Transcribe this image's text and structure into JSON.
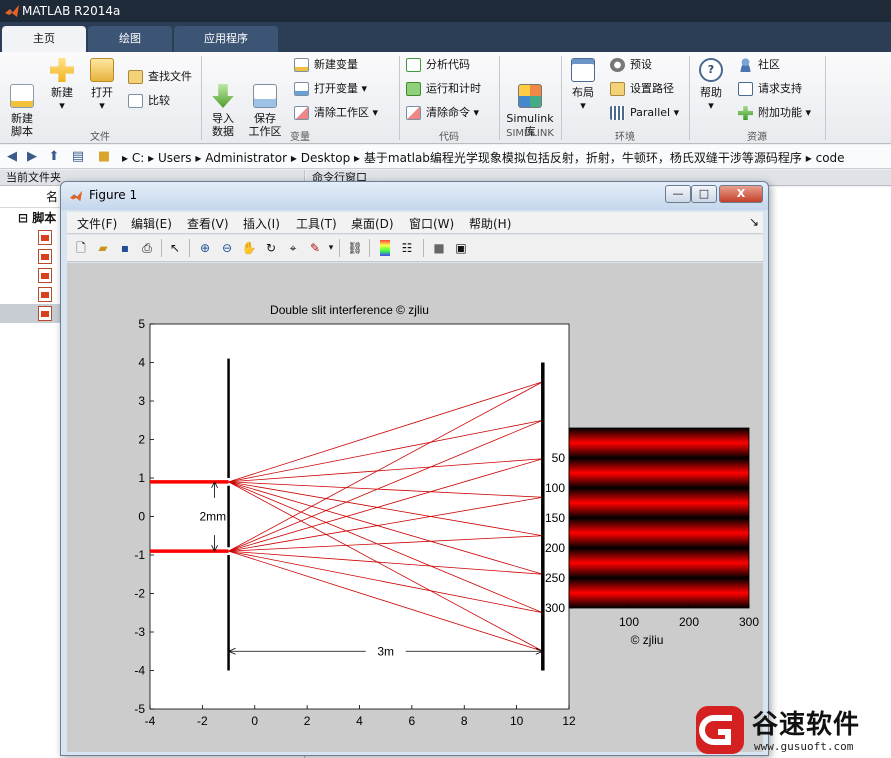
{
  "app": {
    "title": "MATLAB R2014a",
    "tabs": [
      "主页",
      "绘图",
      "应用程序"
    ]
  },
  "ribbon": {
    "new_script": "新建\n脚本",
    "new": "新建",
    "open": "打开",
    "find_files": "查找文件",
    "compare": "比较",
    "import_data": "导入\n数据",
    "save_workspace": "保存\n工作区",
    "new_variable": "新建变量",
    "open_variable": "打开变量",
    "clear_workspace": "清除工作区",
    "analyze_code": "分析代码",
    "run_and_time": "运行和计时",
    "clear_commands": "清除命令",
    "simulink": "Simulink\n库",
    "layout": "布局",
    "preferences": "预设",
    "set_path": "设置路径",
    "parallel": "Parallel",
    "help": "帮助",
    "community": "社区",
    "request_support": "请求支持",
    "add_ons": "附加功能",
    "sections": [
      "文件",
      "变量",
      "代码",
      "SIMULINK",
      "环境",
      "资源"
    ]
  },
  "address": {
    "path": [
      "C:",
      "Users",
      "Administrator",
      "Desktop",
      "基于matlab编程光学现象模拟包括反射，折射，牛顿环，杨氏双缝干涉等源码程序",
      "code"
    ]
  },
  "left_panel": {
    "title": "当前文件夹",
    "column": "名",
    "group": "脚本"
  },
  "command_window": {
    "title": "命令行窗口"
  },
  "figure": {
    "title": "Figure 1",
    "menu": [
      "文件(F)",
      "编辑(E)",
      "查看(V)",
      "插入(I)",
      "工具(T)",
      "桌面(D)",
      "窗口(W)",
      "帮助(H)"
    ],
    "menu_arrow": "↘",
    "window_buttons": {
      "minimize": "—",
      "maximize": "□",
      "close": "X"
    }
  },
  "chart_data": [
    {
      "type": "line",
      "title": "Double slit interference  © zjliu",
      "xlim": [
        -4,
        12
      ],
      "ylim": [
        -5,
        5
      ],
      "xticks": [
        -4,
        -2,
        0,
        2,
        4,
        6,
        8,
        10,
        12
      ],
      "yticks": [
        -5,
        -4,
        -3,
        -2,
        -1,
        0,
        1,
        2,
        3,
        4,
        5
      ],
      "barrier_x": -1,
      "barrier_y": [
        -4,
        4.1
      ],
      "screen_x": 11,
      "screen_y": [
        -4,
        4
      ],
      "slits_y": [
        0.9,
        -0.9
      ],
      "incoming_x": [
        -4,
        -1
      ],
      "ray_targets_y": [
        3.5,
        2.5,
        1.5,
        0.5,
        -0.5,
        -1.5,
        -2.5,
        -3.5
      ],
      "ray_color": "#cc0000",
      "incoming_color": "#ff0000",
      "annotations": [
        {
          "text": "2mm",
          "x": -1.6,
          "y": 0
        },
        {
          "text": "3m",
          "x": 5,
          "y": -3.5
        }
      ]
    },
    {
      "type": "heatmap",
      "xlabel": "© zjliu",
      "xticks": [
        100,
        200,
        300
      ],
      "yticks": [
        50,
        100,
        150,
        200,
        250,
        300
      ],
      "ytick_labels": [
        "50",
        "100",
        "150",
        "200",
        "250",
        "300"
      ],
      "xlim": [
        0,
        300
      ],
      "ylim": [
        0,
        300
      ],
      "fringe_count": 6,
      "colormap": [
        "#000000",
        "#ff0000"
      ]
    }
  ],
  "watermark": {
    "text": "谷速软件",
    "url": "www.gusuoft.com",
    "color": "#d42020"
  }
}
